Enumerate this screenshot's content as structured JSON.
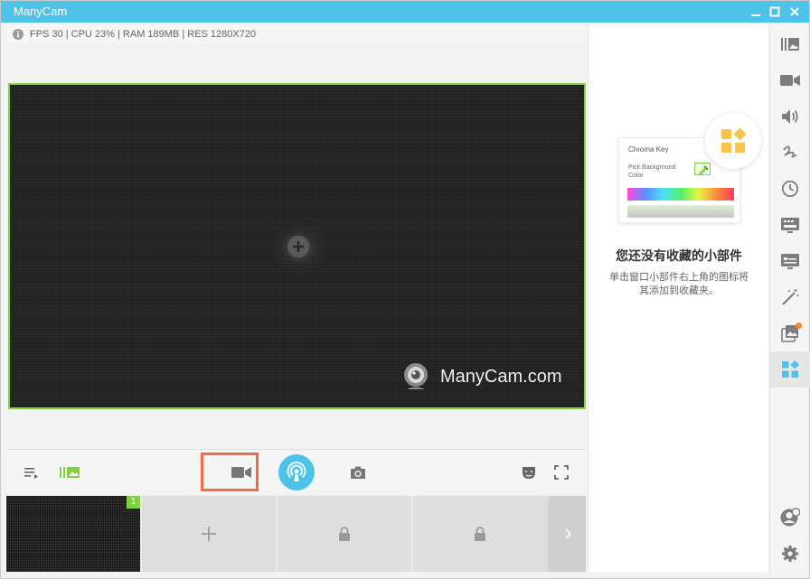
{
  "window": {
    "title": "ManyCam",
    "colors": {
      "titlebar": "#4ec3ea",
      "accent_green": "#7ed13f",
      "highlight_orange": "#f26a46"
    }
  },
  "stats": {
    "text": "FPS 30 | CPU 23% | RAM 189MB | RES 1280X720"
  },
  "preview": {
    "watermark": "ManyCam.com"
  },
  "toolbar": {
    "icons": [
      "playlist-icon",
      "layers-icon",
      "camera-icon",
      "broadcast-icon",
      "snapshot-icon",
      "mask-icon",
      "fullscreen-icon"
    ]
  },
  "sources": {
    "slots": [
      {
        "badge": "1",
        "state": "active"
      },
      {
        "state": "add"
      },
      {
        "state": "locked"
      },
      {
        "state": "locked"
      }
    ]
  },
  "favorites": {
    "illustration": {
      "title": "Chroma Key",
      "pick_label": "Pick Background Color"
    },
    "heading": "您还没有收藏的小部件",
    "description": "单击窗口小部件右上角的图标将其添加到收藏夹。"
  },
  "rail": {
    "items": [
      "presets-icon",
      "video-sources-icon",
      "audio-icon",
      "drawing-icon",
      "time-icon",
      "lower-thirds-icon",
      "text-icon",
      "effects-icon",
      "media-icon",
      "widgets-icon"
    ],
    "bottom": [
      "account-icon",
      "settings-icon"
    ]
  }
}
